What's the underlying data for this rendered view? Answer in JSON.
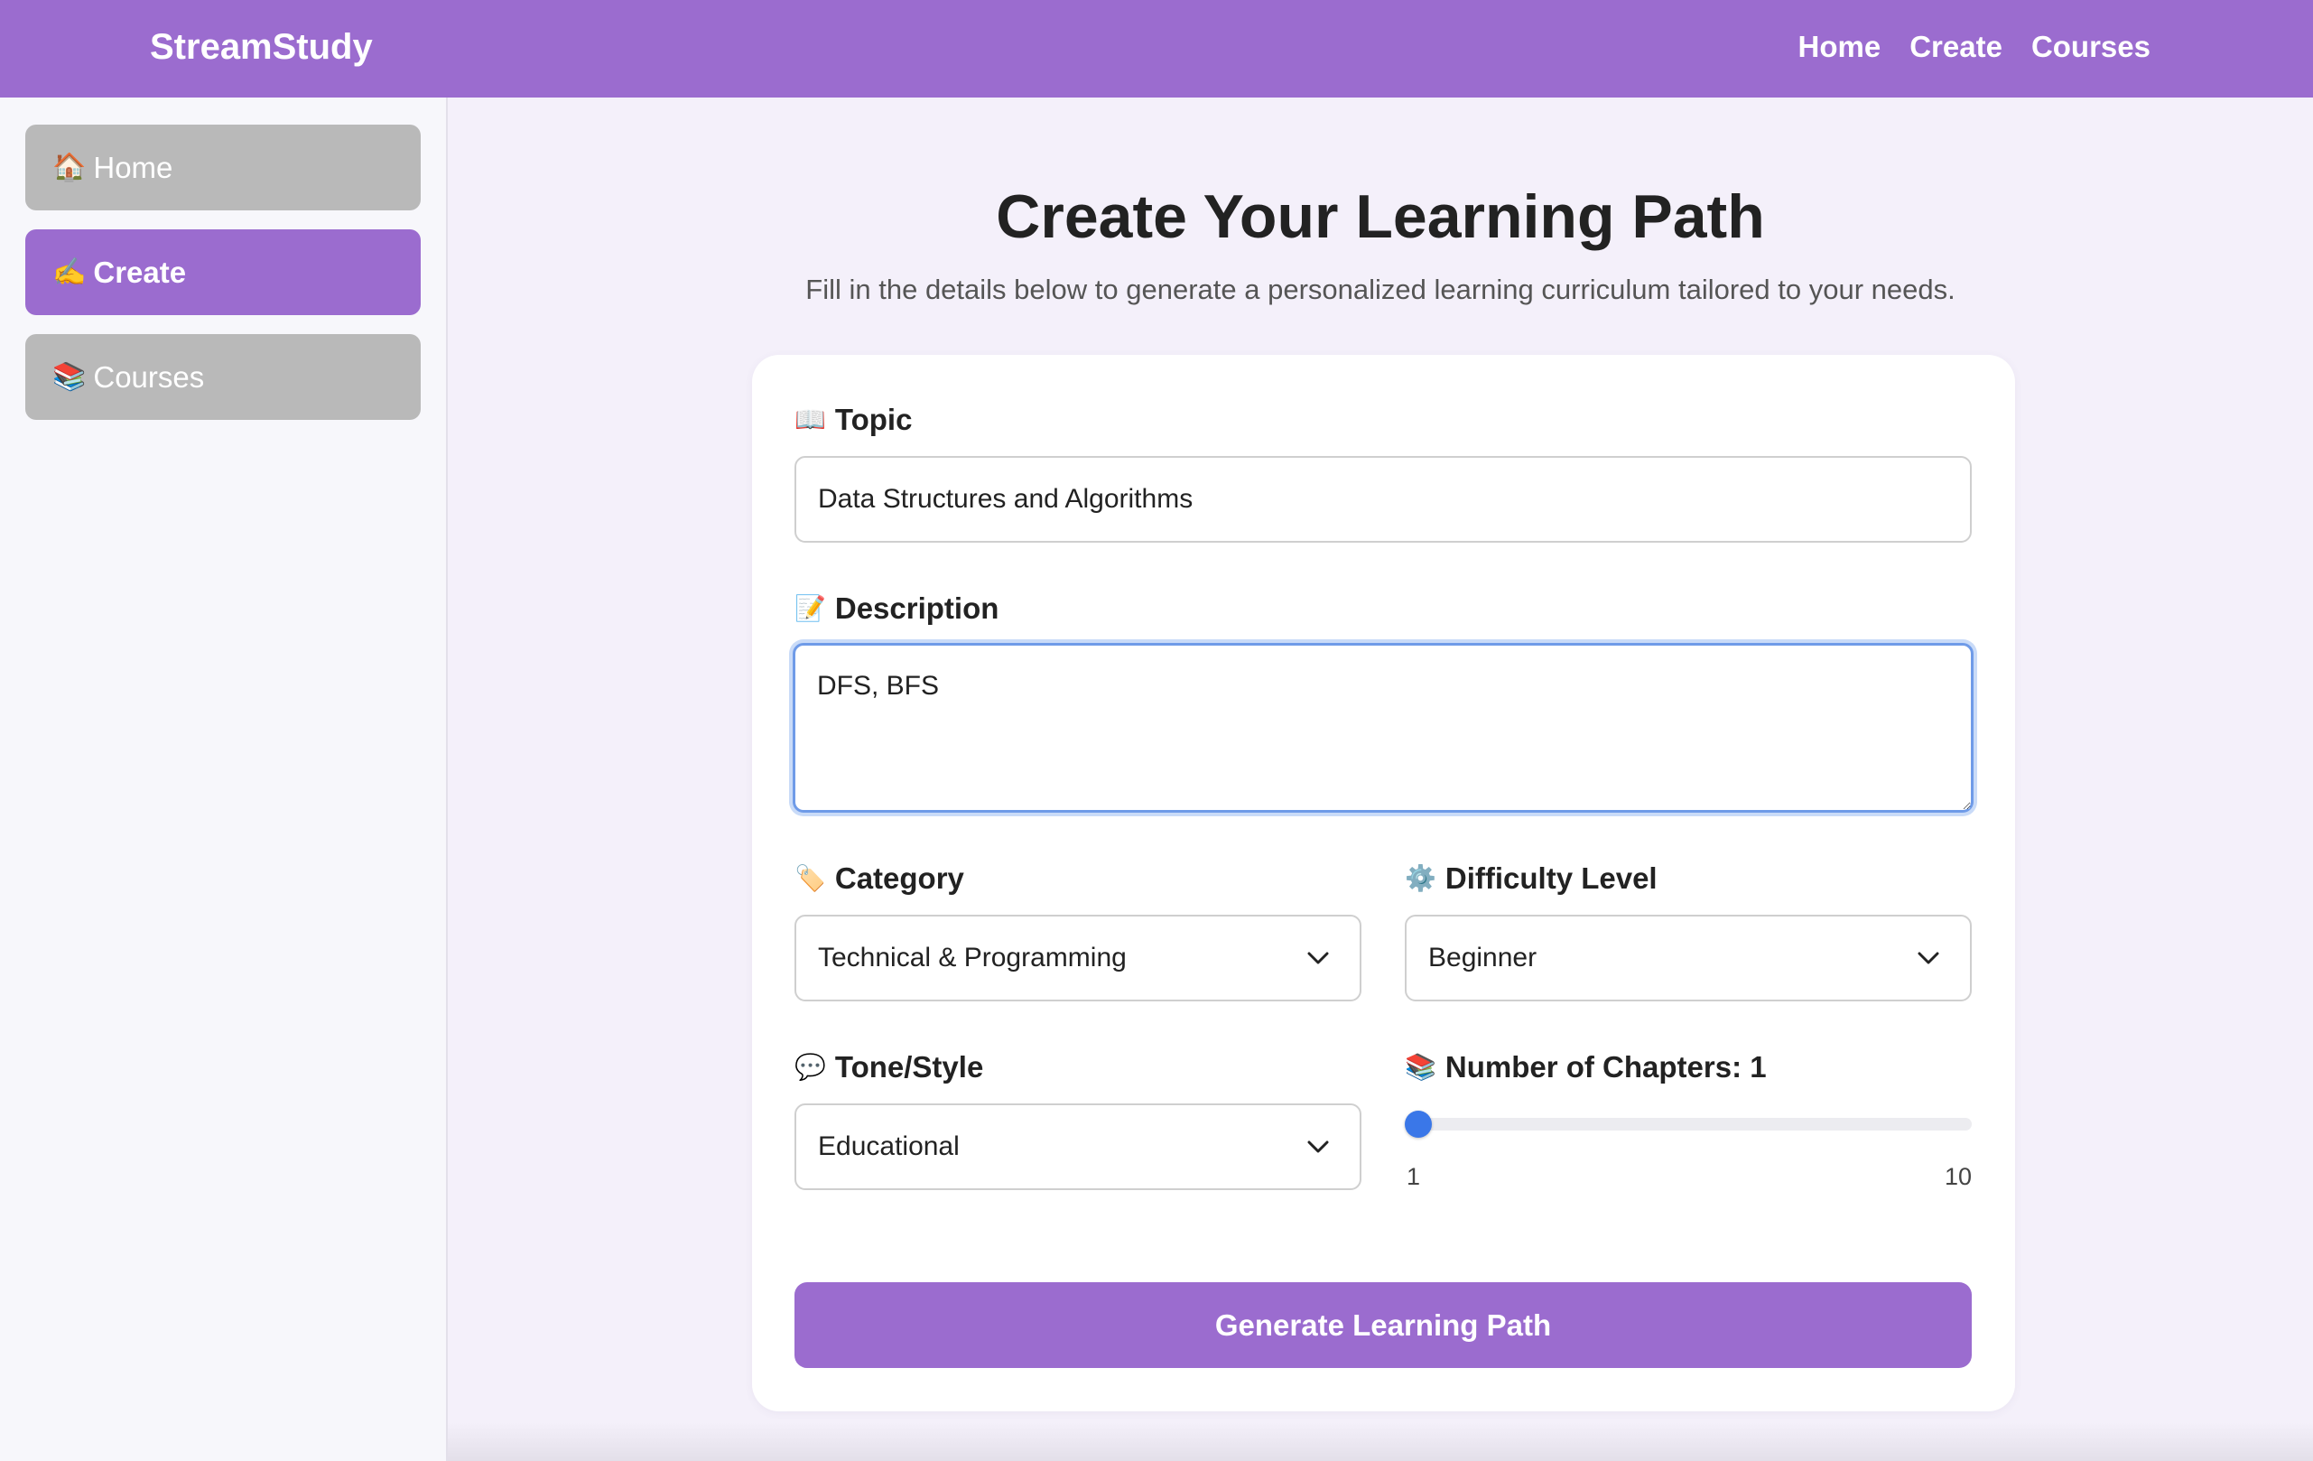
{
  "app": {
    "brand": "StreamStudy"
  },
  "topnav": {
    "items": [
      {
        "label": "Home"
      },
      {
        "label": "Create"
      },
      {
        "label": "Courses"
      }
    ]
  },
  "sidebar": {
    "items": [
      {
        "emoji": "🏠",
        "label": "Home",
        "active": false
      },
      {
        "emoji": "✍️",
        "label": "Create",
        "active": true
      },
      {
        "emoji": "📚",
        "label": "Courses",
        "active": false
      }
    ]
  },
  "main": {
    "title": "Create Your Learning Path",
    "subtitle": "Fill in the details below to generate a personalized learning curriculum tailored to your needs."
  },
  "form": {
    "topic": {
      "emoji": "📖",
      "label": "Topic",
      "value": "Data Structures and Algorithms"
    },
    "description": {
      "emoji": "📝",
      "label": "Description",
      "value": "DFS, BFS"
    },
    "category": {
      "emoji": "🏷️",
      "label": "Category",
      "value": "Technical & Programming"
    },
    "difficulty": {
      "emoji": "⚙️",
      "label": "Difficulty Level",
      "value": "Beginner"
    },
    "tone": {
      "emoji": "💬",
      "label": "Tone/Style",
      "value": "Educational"
    },
    "chapters": {
      "emoji": "📚",
      "label": "Number of Chapters: 1",
      "value": 1,
      "min_label": "1",
      "max_label": "10",
      "min": 1,
      "max": 10
    },
    "submit_label": "Generate Learning Path"
  },
  "colors": {
    "brand": "#9b6ccf",
    "inactive_sidebar": "#b9b9b9",
    "background": "#f4f0fa",
    "focus_ring": "#6f9be8",
    "slider_thumb": "#3a77e8"
  }
}
